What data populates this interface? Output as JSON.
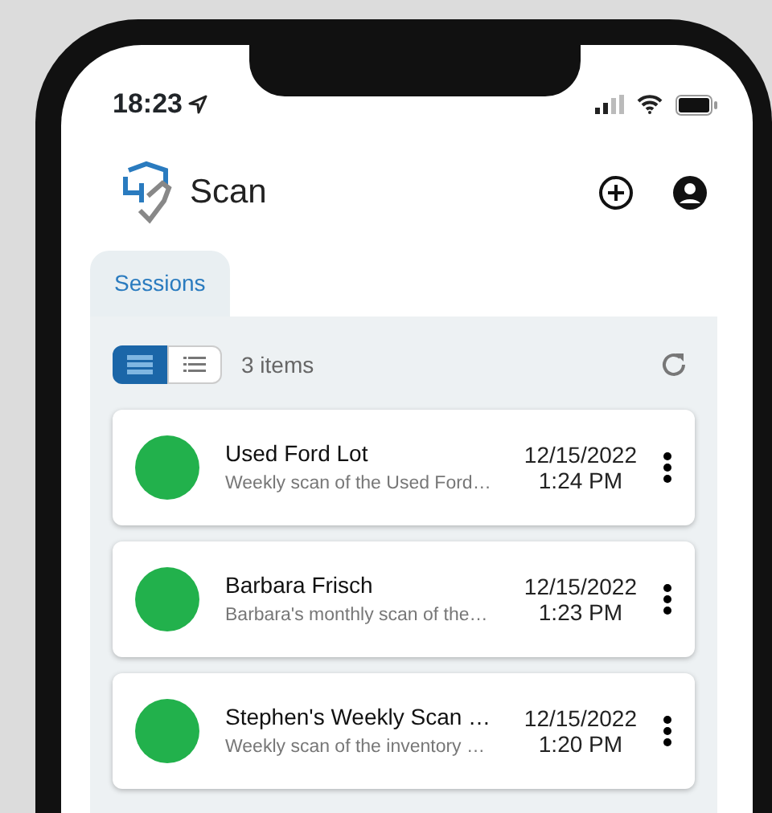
{
  "status_bar": {
    "time": "18:23"
  },
  "header": {
    "title": "Scan"
  },
  "tabs": [
    {
      "label": "Sessions",
      "selected": true
    }
  ],
  "toolbar": {
    "views": [
      {
        "kind": "cards",
        "selected": true
      },
      {
        "kind": "list",
        "selected": false
      }
    ],
    "count": "3 items"
  },
  "sessions": [
    {
      "name": "Used Ford Lot",
      "description": "Weekly scan of the Used Ford…",
      "date": "12/15/2022",
      "time": "1:24 PM",
      "color": "#22b14c"
    },
    {
      "name": "Barbara Frisch",
      "description": "Barbara's monthly scan of the…",
      "date": "12/15/2022",
      "time": "1:23 PM",
      "color": "#22b14c"
    },
    {
      "name": "Stephen's Weekly Scan …",
      "description": "Weekly scan of the inventory …",
      "date": "12/15/2022",
      "time": "1:20 PM",
      "color": "#22b14c"
    }
  ]
}
